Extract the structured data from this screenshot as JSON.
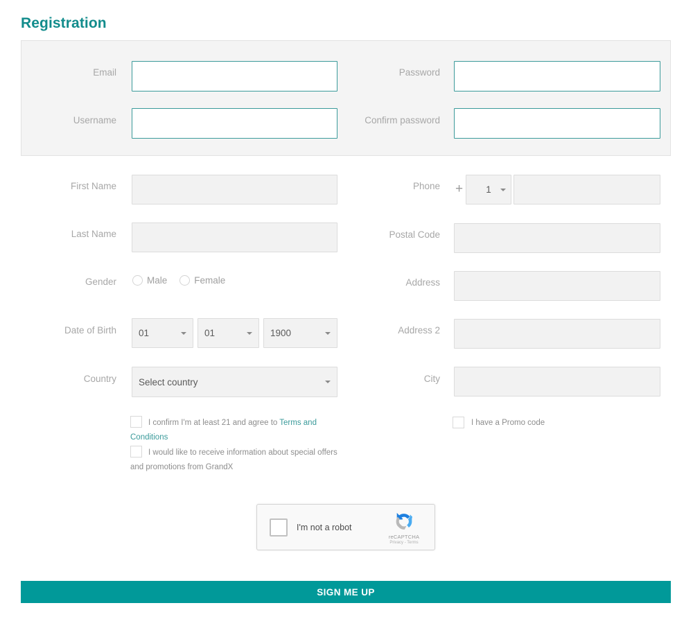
{
  "page": {
    "title": "Registration",
    "accent_color": "#128c8c",
    "button_color": "#019999",
    "panel_bg": "#f4f4f4"
  },
  "credentials": {
    "email": {
      "label": "Email",
      "value": "",
      "placeholder": ""
    },
    "username": {
      "label": "Username",
      "value": "",
      "placeholder": ""
    },
    "password": {
      "label": "Password",
      "value": "",
      "placeholder": ""
    },
    "confirm_password": {
      "label": "Confirm password",
      "value": "",
      "placeholder": ""
    }
  },
  "personal": {
    "first_name": {
      "label": "First Name",
      "value": "",
      "placeholder": ""
    },
    "last_name": {
      "label": "Last Name",
      "value": "",
      "placeholder": ""
    },
    "gender": {
      "label": "Gender",
      "options": [
        "Male",
        "Female"
      ],
      "selected": ""
    },
    "date_of_birth": {
      "label": "Date of Birth",
      "day": "01",
      "month": "01",
      "year": "1900"
    },
    "country": {
      "label": "Country",
      "selected": "Select country"
    }
  },
  "contact": {
    "phone": {
      "label": "Phone",
      "prefix_symbol": "+",
      "country_code": "1",
      "number": "",
      "placeholder": ""
    },
    "postal_code": {
      "label": "Postal Code",
      "value": "",
      "placeholder": ""
    },
    "address": {
      "label": "Address",
      "value": "",
      "placeholder": ""
    },
    "address2": {
      "label": "Address 2",
      "value": "",
      "placeholder": ""
    },
    "city": {
      "label": "City",
      "value": "",
      "placeholder": ""
    }
  },
  "agreements": {
    "terms": {
      "text_before": "I confirm I'm at least 21 and agree to ",
      "link_text": "Terms and Conditions",
      "checked": false
    },
    "marketing": {
      "text": "I would like to receive information about special offers and promotions from GrandX",
      "checked": false
    },
    "promo": {
      "text": "I have a Promo code",
      "checked": false
    }
  },
  "captcha": {
    "label": "I'm not a robot",
    "brand": "reCAPTCHA",
    "privacy": "Privacy",
    "separator": "-",
    "terms": "Terms",
    "checked": false
  },
  "submit": {
    "label": "SIGN ME UP"
  }
}
